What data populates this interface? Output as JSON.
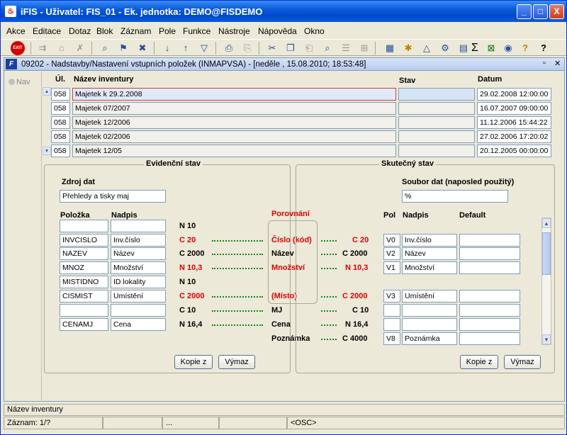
{
  "window": {
    "title": "iFIS - Uživatel: FIS_01 - Ek. jednotka: DEMO@FISDEMO",
    "minimize": "_",
    "maximize": "□",
    "close": "X"
  },
  "menu": [
    "Akce",
    "Editace",
    "Dotaz",
    "Blok",
    "Záznam",
    "Pole",
    "Funkce",
    "Nástroje",
    "Nápověda",
    "Okno"
  ],
  "toolbar": {
    "exit_label": "EXIT",
    "sigma": "Σ"
  },
  "form": {
    "icon": "F",
    "title": "09202 - Nadstavby/Nastavení vstupních položek (INMAPVSA) - [neděle , 15.08.2010; 18:53:48]",
    "restore": "▫",
    "close": "✕"
  },
  "nav_tab": "Nav",
  "table": {
    "headers": {
      "ul": "Úl.",
      "name": "Název inventury",
      "stav": "Stav",
      "datum": "Datum"
    },
    "rows": [
      {
        "ul": "058",
        "name": "Majetek k 29.2.2008",
        "stav": "",
        "datum": "29.02.2008 12:00:00"
      },
      {
        "ul": "058",
        "name": "Majetek 07/2007",
        "stav": "",
        "datum": "16.07.2007 09:00:00"
      },
      {
        "ul": "058",
        "name": "Majetek 12/2006",
        "stav": "",
        "datum": "11.12.2006 15:44:22"
      },
      {
        "ul": "058",
        "name": "Majetek 02/2006",
        "stav": "",
        "datum": "27.02.2006 17:20:02"
      },
      {
        "ul": "058",
        "name": "Majetek 12/05",
        "stav": "",
        "datum": "20.12.2005 00:00:00"
      }
    ]
  },
  "evidencni": {
    "title": "Evidenční stav",
    "zdroj_label": "Zdroj dat",
    "zdroj_value": "Přehledy a tisky maj",
    "col_polozka": "Položka",
    "col_nadpis": "Nadpis",
    "rows": [
      {
        "polozka": "",
        "nadpis": "",
        "type": "N 10",
        "red": false
      },
      {
        "polozka": "INVCISLO",
        "nadpis": "Inv.číslo",
        "type": "C 20",
        "red": true
      },
      {
        "polozka": "NAZEV",
        "nadpis": "Název",
        "type": "C 2000",
        "red": false
      },
      {
        "polozka": "MNOZ",
        "nadpis": "Množství",
        "type": "N 10,3",
        "red": true
      },
      {
        "polozka": "MISTIDNO",
        "nadpis": "ID lokality",
        "type": "N 10",
        "red": false
      },
      {
        "polozka": "CISMIST",
        "nadpis": "Umístění",
        "type": "C 2000",
        "red": true
      },
      {
        "polozka": "",
        "nadpis": "",
        "type": "C 10",
        "red": false
      },
      {
        "polozka": "CENAMJ",
        "nadpis": "Cena",
        "type": "N 16,4",
        "red": false
      }
    ],
    "btn_kopie": "Kopie z",
    "btn_vymaz": "Výmaz"
  },
  "porovnani": {
    "title": "Porovnání",
    "rows": [
      {
        "label": "Číslo (kód)",
        "type": "C 20",
        "red": true
      },
      {
        "label": "Název",
        "type": "C 2000",
        "red": false
      },
      {
        "label": "Množství",
        "type": "N 10,3",
        "red": true
      },
      {
        "label": "(Místo)",
        "type": "C 2000",
        "red": true
      },
      {
        "label": "MJ",
        "type": "C 10",
        "red": false
      },
      {
        "label": "Cena",
        "type": "N 16,4",
        "red": false
      },
      {
        "label": "Poznámka",
        "type": "C 4000",
        "red": false
      }
    ]
  },
  "skutecny": {
    "title": "Skutečný stav",
    "soubor_label": "Soubor dat (naposled použitý)",
    "soubor_value": "%",
    "col_pol": "Pol",
    "col_nadpis": "Nadpis",
    "col_default": "Default",
    "rows": [
      {
        "pol": "V0",
        "nadpis": "Inv.číslo",
        "default": ""
      },
      {
        "pol": "V2",
        "nadpis": "Název",
        "default": ""
      },
      {
        "pol": "V1",
        "nadpis": "Množství",
        "default": ""
      },
      {
        "pol": "V3",
        "nadpis": "Umístění",
        "default": ""
      },
      {
        "pol": "",
        "nadpis": "",
        "default": ""
      },
      {
        "pol": "",
        "nadpis": "",
        "default": ""
      },
      {
        "pol": "V8",
        "nadpis": "Poznámka",
        "default": ""
      }
    ],
    "btn_kopie": "Kopie z",
    "btn_vymaz": "Výmaz"
  },
  "status": {
    "field_name": "Název inventury",
    "record": "Záznam: 1/?",
    "seg3": "...",
    "osc": "<OSC>"
  }
}
